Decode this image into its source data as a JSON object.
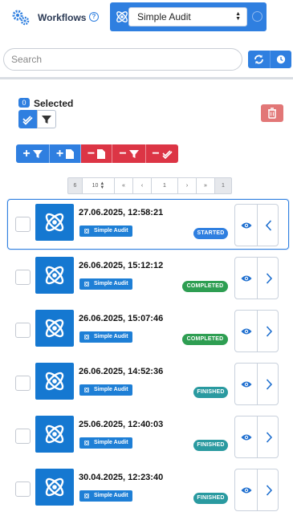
{
  "header": {
    "title": "Workflows",
    "help_icon": "question-circle-icon",
    "selected_workflow": "Simple Audit",
    "select_icon": "atom-icon",
    "colors": {
      "primary": "#2f7fe0",
      "dark": "#2b3a55"
    }
  },
  "search": {
    "placeholder": "Search"
  },
  "toolbar": {
    "refresh_icon": "refresh-icon",
    "history_icon": "clock-icon"
  },
  "selection": {
    "count": "0",
    "label": "Selected",
    "select_all_icon": "double-check-icon",
    "filter_icon": "filter-icon",
    "delete_icon": "trash-icon",
    "delete_color": "#e27777"
  },
  "actions": [
    {
      "name": "add-filter",
      "sign": "+",
      "icon": "filter-icon",
      "color": "blue"
    },
    {
      "name": "add-document",
      "sign": "+",
      "icon": "document-icon",
      "color": "blue"
    },
    {
      "name": "remove-document",
      "sign": "−",
      "icon": "document-icon",
      "color": "red"
    },
    {
      "name": "remove-filter",
      "sign": "−",
      "icon": "filter-icon",
      "color": "red"
    },
    {
      "name": "remove-checked",
      "sign": "−",
      "icon": "double-check-icon",
      "color": "red"
    }
  ],
  "pagination": {
    "total": "6",
    "page_size": "10",
    "first": "«",
    "prev": "‹",
    "current": "1",
    "next": "›",
    "last": "»",
    "page_count": "1"
  },
  "status_colors": {
    "STARTED": "#2f7fe0",
    "COMPLETED": "#2e9e52",
    "FINISHED": "#2a9aa0"
  },
  "rows": [
    {
      "date": "27.06.2025, 12:58:21",
      "workflow": "Simple Audit",
      "status": "STARTED",
      "active": true
    },
    {
      "date": "26.06.2025, 15:12:12",
      "workflow": "Simple Audit",
      "status": "COMPLETED",
      "active": false
    },
    {
      "date": "26.06.2025, 15:07:46",
      "workflow": "Simple Audit",
      "status": "COMPLETED",
      "active": false
    },
    {
      "date": "26.06.2025, 14:52:36",
      "workflow": "Simple Audit",
      "status": "FINISHED",
      "active": false
    },
    {
      "date": "25.06.2025, 12:40:03",
      "workflow": "Simple Audit",
      "status": "FINISHED",
      "active": false
    },
    {
      "date": "30.04.2025, 12:23:40",
      "workflow": "Simple Audit",
      "status": "FINISHED",
      "active": false
    }
  ]
}
